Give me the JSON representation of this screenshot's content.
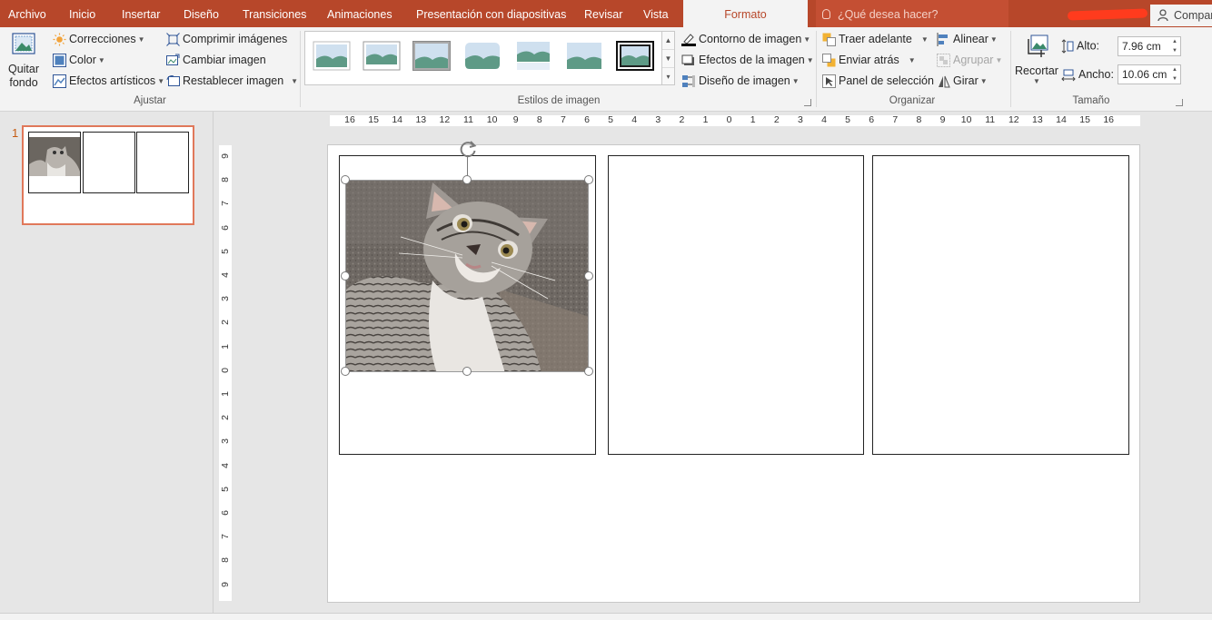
{
  "tabs": [
    {
      "label": "Archivo"
    },
    {
      "label": "Inicio"
    },
    {
      "label": "Insertar"
    },
    {
      "label": "Diseño"
    },
    {
      "label": "Transiciones"
    },
    {
      "label": "Animaciones"
    },
    {
      "label": "Presentación con diapositivas"
    },
    {
      "label": "Revisar"
    },
    {
      "label": "Vista"
    },
    {
      "label": "Formato",
      "active": true
    }
  ],
  "tell_me": {
    "placeholder": "¿Qué desea hacer?"
  },
  "share": {
    "label": "Compar"
  },
  "ribbon": {
    "ajustar": {
      "quitar_fondo_line1": "Quitar",
      "quitar_fondo_line2": "fondo",
      "correcciones": "Correcciones",
      "color": "Color",
      "efectos_artisticos": "Efectos artísticos",
      "comprimir": "Comprimir imágenes",
      "cambiar": "Cambiar imagen",
      "restablecer": "Restablecer imagen",
      "label": "Ajustar"
    },
    "estilos": {
      "label": "Estilos de imagen",
      "contorno": "Contorno de imagen",
      "efectos": "Efectos de la imagen",
      "diseno": "Diseño de imagen"
    },
    "organizar": {
      "traer": "Traer adelante",
      "enviar": "Enviar atrás",
      "panel": "Panel de selección",
      "alinear": "Alinear",
      "agrupar": "Agrupar",
      "girar": "Girar",
      "label": "Organizar"
    },
    "tamano": {
      "recortar": "Recortar",
      "alto_label": "Alto:",
      "alto_value": "7.96 cm",
      "ancho_label": "Ancho:",
      "ancho_value": "10.06 cm",
      "label": "Tamaño"
    }
  },
  "slide_panel": {
    "slide_number": "1"
  },
  "ruler_h": [
    "16",
    "15",
    "14",
    "13",
    "12",
    "11",
    "10",
    "9",
    "8",
    "7",
    "6",
    "5",
    "4",
    "3",
    "2",
    "1",
    "0",
    "1",
    "2",
    "3",
    "4",
    "5",
    "6",
    "7",
    "8",
    "9",
    "10",
    "11",
    "12",
    "13",
    "14",
    "15",
    "16"
  ],
  "ruler_v": [
    "9",
    "8",
    "7",
    "6",
    "5",
    "4",
    "3",
    "2",
    "1",
    "0",
    "1",
    "2",
    "3",
    "4",
    "5",
    "6",
    "7",
    "8",
    "9"
  ],
  "colors": {
    "accent": "#b7472a",
    "selected_thumb_border": "#e0785a"
  }
}
